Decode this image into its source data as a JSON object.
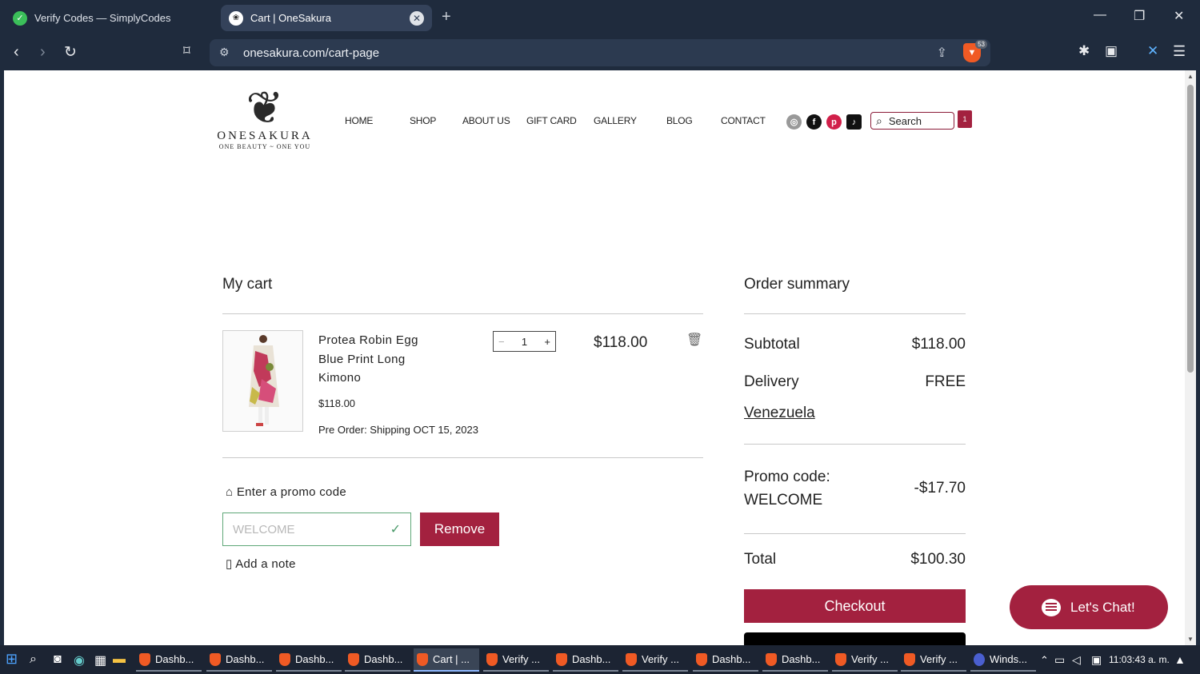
{
  "browser": {
    "tabs": [
      {
        "title": "Verify Codes — SimplyCodes"
      },
      {
        "title": "Cart | OneSakura"
      }
    ],
    "url": "onesakura.com/cart-page",
    "shield_badge": "53"
  },
  "site": {
    "logo_name": "ONESAKURA",
    "logo_tagline": "ONE BEAUTY ~ ONE YOU",
    "nav": [
      "HOME",
      "SHOP",
      "ABOUT US",
      "GIFT CARD",
      "GALLERY",
      "BLOG",
      "CONTACT"
    ],
    "search_placeholder": "Search",
    "cart_count": "1"
  },
  "cart": {
    "title": "My cart",
    "item": {
      "name": "Protea Robin Egg Blue Print Long Kimono",
      "price": "$118.00",
      "preorder": "Pre Order: Shipping OCT 15, 2023",
      "quantity": "1",
      "line_total": "$118.00"
    },
    "promo_link": "Enter a promo code",
    "promo_value": "WELCOME",
    "remove_label": "Remove",
    "note_link": "Add a note"
  },
  "summary": {
    "title": "Order summary",
    "subtotal_label": "Subtotal",
    "subtotal": "$118.00",
    "delivery_label": "Delivery",
    "delivery": "FREE",
    "country": "Venezuela",
    "promo_label": "Promo code:",
    "promo_code": "WELCOME",
    "promo_discount": "-$17.70",
    "total_label": "Total",
    "total": "$100.30",
    "checkout_label": "Checkout"
  },
  "chat": {
    "label": "Let's Chat!"
  },
  "taskbar": {
    "apps": [
      "Dashb...",
      "Dashb...",
      "Dashb...",
      "Dashb...",
      "Cart | ...",
      "Verify ...",
      "Dashb...",
      "Verify ...",
      "Dashb...",
      "Dashb...",
      "Verify ...",
      "Verify ...",
      "Winds..."
    ],
    "clock": "11:03:43 a. m."
  },
  "colors": {
    "accent": "#a3213f",
    "chrome": "#1f2b3d"
  }
}
